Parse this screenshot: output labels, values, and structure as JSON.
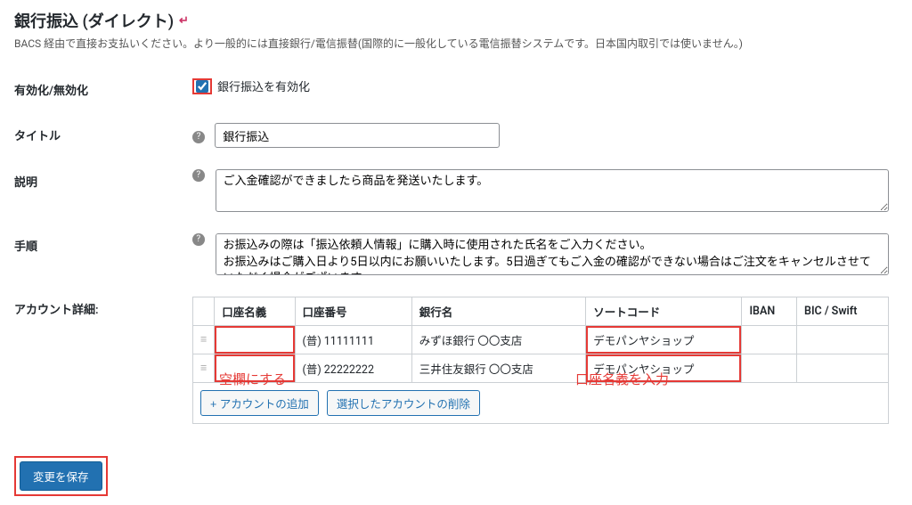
{
  "page": {
    "title": "銀行振込 (ダイレクト)",
    "back_symbol": "↵",
    "description": "BACS 経由で直接お支払いください。より一般的には直接銀行/電信振替(国際的に一般化している電信振替システムです。日本国内取引では使いません。)"
  },
  "fields": {
    "enable": {
      "label": "有効化/無効化",
      "checkbox_label": "銀行振込を有効化",
      "checked": true
    },
    "title": {
      "label": "タイトル",
      "value": "銀行振込"
    },
    "desc": {
      "label": "説明",
      "value": "ご入金確認ができましたら商品を発送いたします。"
    },
    "instructions": {
      "label": "手順",
      "value": "お振込みの際は「振込依頼人情報」に購入時に使用された氏名をご入力ください。\nお振込みはご購入日より5日以内にお願いいたします。5日過ぎてもご入金の確認ができない場合はご注文をキャンセルさせていただく場合がございます。"
    },
    "accounts": {
      "label": "アカウント詳細:",
      "headers": {
        "name": "口座名義",
        "number": "口座番号",
        "bank": "銀行名",
        "sort": "ソートコード",
        "iban": "IBAN",
        "bic": "BIC / Swift"
      },
      "rows": [
        {
          "name": "",
          "number": "(普) 11111111",
          "bank": "みずほ銀行 〇〇支店",
          "sort": "デモパンヤショップ",
          "iban": "",
          "bic": ""
        },
        {
          "name": "",
          "number": "(普) 22222222",
          "bank": "三井住友銀行 〇〇支店",
          "sort": "デモパンヤショップ",
          "iban": "",
          "bic": ""
        }
      ],
      "buttons": {
        "add": "+ アカウントの追加",
        "remove": "選択したアカウントの削除"
      }
    }
  },
  "annotations": {
    "blank": "空欄にする",
    "name_input": "口座名義を入力"
  },
  "save_button": "変更を保存"
}
